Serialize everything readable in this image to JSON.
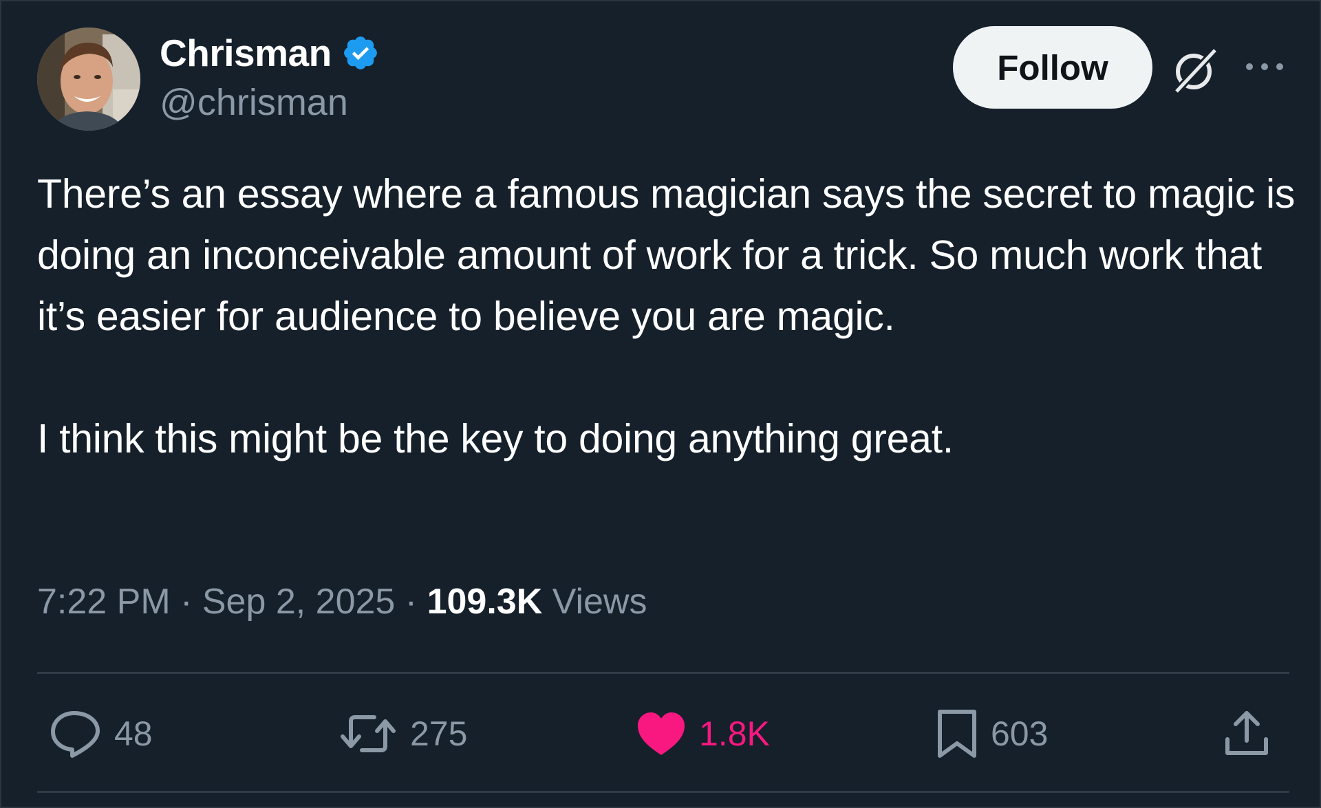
{
  "author": {
    "display_name": "Chrisman",
    "handle": "@chrisman",
    "verified": true,
    "verified_color": "#1d9bf0"
  },
  "header": {
    "follow_label": "Follow",
    "grok_icon": "grok-icon",
    "more_icon": "more-icon"
  },
  "tweet": {
    "paragraphs": [
      "There’s an essay where a famous magician says the secret to magic is doing an inconceivable amount of work for a trick. So much work that it’s easier for audience to believe you are magic.",
      "I think this might be the key to doing anything great."
    ]
  },
  "meta": {
    "time": "7:22 PM",
    "separator": " · ",
    "date": "Sep 2, 2025",
    "views_count": "109.3K",
    "views_label": "Views"
  },
  "actions": {
    "replies": "48",
    "reposts": "275",
    "likes": "1.8K",
    "bookmarks": "603",
    "like_color": "#f91880"
  },
  "colors": {
    "background": "#15202b",
    "primary_text": "#ffffff",
    "secondary_text": "#8b98a5",
    "divider": "#2f3b47"
  }
}
